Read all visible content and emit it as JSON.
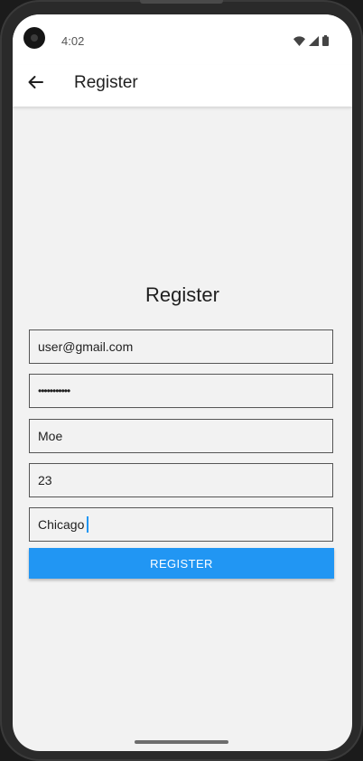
{
  "status_bar": {
    "time": "4:02",
    "icons": [
      "wifi-icon",
      "cell-signal-icon",
      "battery-icon"
    ]
  },
  "app_bar": {
    "title": "Register",
    "back_icon": "arrow-left-icon"
  },
  "form": {
    "heading": "Register",
    "email_value": "user@gmail.com",
    "password_value": "•••••••••••",
    "name_value": "Moe",
    "age_value": "23",
    "city_value": "Chicago",
    "submit_label": "REGISTER"
  },
  "colors": {
    "accent": "#2196f3",
    "background": "#f2f2f2",
    "app_bar": "#ffffff"
  }
}
